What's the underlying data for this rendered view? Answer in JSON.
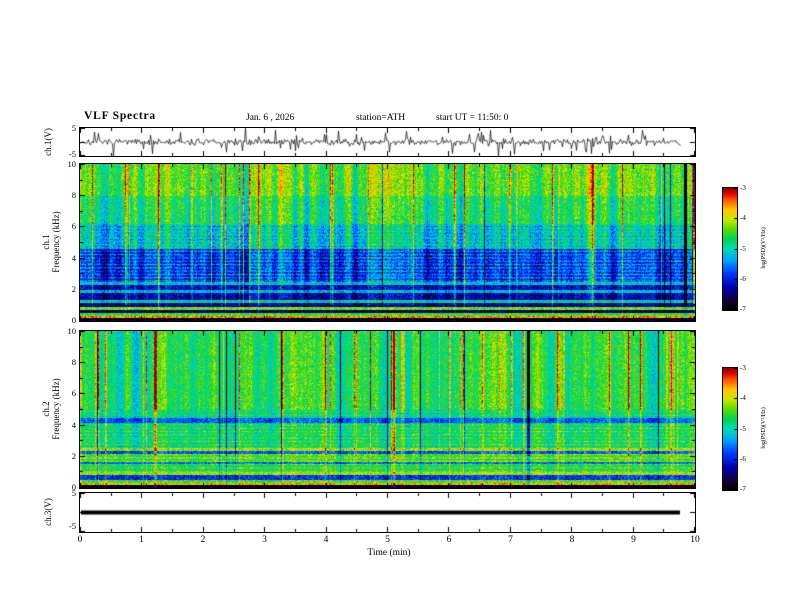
{
  "header": {
    "title": "VLF Spectra",
    "date": "Jan. 6 , 2026",
    "station": "station=ATH",
    "start_ut": "start UT =  11:50: 0"
  },
  "axes": {
    "time_label": "Time (min)",
    "time_ticks": [
      0,
      1,
      2,
      3,
      4,
      5,
      6,
      7,
      8,
      9,
      10
    ],
    "time_range_min": [
      0,
      10
    ]
  },
  "panels": {
    "waveform": {
      "ylabel": "ch.1(V)",
      "ymax": "5",
      "ymin": "-5"
    },
    "spec1": {
      "channel": "ch.1",
      "axis": "Frequency (kHz)",
      "yticks": [
        10,
        8,
        6,
        4,
        2,
        0
      ]
    },
    "spec2": {
      "channel": "ch.2",
      "axis": "Frequency (kHz)",
      "yticks": [
        10,
        8,
        6,
        4,
        2,
        0
      ]
    },
    "ch3": {
      "ylabel": "ch.3(V)",
      "ymax": "5",
      "ymin": "-5"
    }
  },
  "colorbar": {
    "label": "log(PSD)(V²/Hz)",
    "ticks": [
      -3,
      -4,
      -5,
      -6,
      -7
    ],
    "zlim": [
      -7,
      -3
    ],
    "colormap": [
      {
        "t": 0.0,
        "c": "#000000"
      },
      {
        "t": 0.08,
        "c": "#14003c"
      },
      {
        "t": 0.18,
        "c": "#0000b4"
      },
      {
        "t": 0.3,
        "c": "#003cff"
      },
      {
        "t": 0.4,
        "c": "#00a0ff"
      },
      {
        "t": 0.5,
        "c": "#00dcb4"
      },
      {
        "t": 0.58,
        "c": "#00d25a"
      },
      {
        "t": 0.66,
        "c": "#5adc00"
      },
      {
        "t": 0.74,
        "c": "#c8e600"
      },
      {
        "t": 0.82,
        "c": "#ffc800"
      },
      {
        "t": 0.9,
        "c": "#ff5a00"
      },
      {
        "t": 0.96,
        "c": "#dc0000"
      },
      {
        "t": 1.0,
        "c": "#8c0000"
      }
    ]
  },
  "chart_data": [
    {
      "id": "ch1-waveform",
      "type": "line",
      "title": "ch.1 voltage waveform",
      "xlabel": "Time (min)",
      "ylabel": "ch.1(V)",
      "xlim": [
        0,
        10
      ],
      "ylim": [
        -5,
        5
      ],
      "data_end_min": 9.75,
      "noise_amp_v": 1.1,
      "spike_prob": 0.1,
      "spike_amp_v": 3.0,
      "seed": 7,
      "color": "#000000"
    },
    {
      "id": "ch1-spectrogram",
      "type": "heatmap",
      "title": "ch.1 VLF spectrogram",
      "xlabel": "Time (min)",
      "ylabel": "Frequency (kHz)",
      "zlabel": "log(PSD)(V²/Hz)",
      "xlim": [
        0,
        10
      ],
      "ylim": [
        0,
        10
      ],
      "zlim": [
        -7,
        -3
      ],
      "seed": 42,
      "speckle": 0.9,
      "bands": [
        {
          "f": [
            0.0,
            0.18
          ],
          "v": -6.9
        },
        {
          "f": [
            0.18,
            0.32
          ],
          "v": -3.6
        },
        {
          "f": [
            0.32,
            0.5
          ],
          "v": -4.5
        },
        {
          "f": [
            0.5,
            0.68
          ],
          "v": -6.6
        },
        {
          "f": [
            0.68,
            0.88
          ],
          "v": -4.3
        },
        {
          "f": [
            0.88,
            1.1
          ],
          "v": -6.4
        },
        {
          "f": [
            1.1,
            1.3
          ],
          "v": -5.0
        },
        {
          "f": [
            1.3,
            1.75
          ],
          "v": -6.3
        },
        {
          "f": [
            1.75,
            1.95
          ],
          "v": -5.2
        },
        {
          "f": [
            1.95,
            2.3
          ],
          "v": -6.2
        },
        {
          "f": [
            2.3,
            2.5
          ],
          "v": -5.1
        },
        {
          "f": [
            2.5,
            4.6
          ],
          "v": -5.8,
          "hs": 0.45
        },
        {
          "f": [
            4.6,
            6.2
          ],
          "v": -5.1,
          "hs": 0.25
        },
        {
          "f": [
            6.2,
            8.0
          ],
          "v": -4.7
        },
        {
          "f": [
            8.0,
            10.01
          ],
          "v": -4.4
        }
      ],
      "stripe": {
        "smooth_amp": 0.55,
        "impulse_prob": 0.05,
        "impulse_amp": [
          0.7,
          1.6
        ],
        "dark_prob": 0.01,
        "dark_amp": 1.5,
        "gain_bands": [
          {
            "f": [
              0.0,
              1.0
            ],
            "gain": 0.25
          },
          {
            "f": [
              1.0,
              2.5
            ],
            "gain": 0.6
          },
          {
            "f": [
              2.5,
              10.01
            ],
            "gain": 1.0
          }
        ]
      },
      "dark_lines_min": [
        9.85
      ]
    },
    {
      "id": "ch2-spectrogram",
      "type": "heatmap",
      "title": "ch.2 VLF spectrogram",
      "xlabel": "Time (min)",
      "ylabel": "Frequency (kHz)",
      "zlabel": "log(PSD)(V²/Hz)",
      "xlim": [
        0,
        10
      ],
      "ylim": [
        0,
        10
      ],
      "zlim": [
        -7,
        -3
      ],
      "seed": 1337,
      "speckle": 0.8,
      "bands": [
        {
          "f": [
            0.0,
            0.14
          ],
          "v": -6.9
        },
        {
          "f": [
            0.14,
            0.3
          ],
          "v": -3.7
        },
        {
          "f": [
            0.3,
            0.5
          ],
          "v": -4.4
        },
        {
          "f": [
            0.5,
            0.8
          ],
          "v": -5.9
        },
        {
          "f": [
            0.8,
            1.0
          ],
          "v": -4.1
        },
        {
          "f": [
            1.0,
            1.5
          ],
          "v": -4.6,
          "hs": 0.3
        },
        {
          "f": [
            1.5,
            1.65
          ],
          "v": -5.6
        },
        {
          "f": [
            1.65,
            2.15
          ],
          "v": -4.4,
          "hs": 0.3
        },
        {
          "f": [
            2.15,
            2.35
          ],
          "v": -5.7
        },
        {
          "f": [
            2.35,
            2.55
          ],
          "v": -4.1
        },
        {
          "f": [
            2.55,
            4.15
          ],
          "v": -4.7,
          "hs": 0.35
        },
        {
          "f": [
            4.15,
            4.45
          ],
          "v": -5.7
        },
        {
          "f": [
            4.45,
            5.0
          ],
          "v": -4.8,
          "hs": 0.3
        },
        {
          "f": [
            5.0,
            10.01
          ],
          "v": -4.6
        }
      ],
      "stripe": {
        "smooth_amp": 0.5,
        "impulse_prob": 0.06,
        "impulse_amp": [
          0.8,
          1.7
        ],
        "dark_prob": 0.018,
        "dark_amp": 2.4,
        "gain_bands": [
          {
            "f": [
              0.0,
              2.0
            ],
            "gain": 0.3
          },
          {
            "f": [
              2.0,
              5.0
            ],
            "gain": 0.55
          },
          {
            "f": [
              5.0,
              10.01
            ],
            "gain": 1.0
          }
        ]
      },
      "dark_lines_min": [
        7.3
      ]
    },
    {
      "id": "ch3-line",
      "type": "line",
      "title": "ch.3 voltage (flat)",
      "xlabel": "Time (min)",
      "ylabel": "ch.3(V)",
      "xlim": [
        0,
        10
      ],
      "ylim": [
        -5,
        5
      ],
      "data_end_min": 9.75,
      "value": 0,
      "line_width": 4,
      "color": "#000000"
    }
  ]
}
